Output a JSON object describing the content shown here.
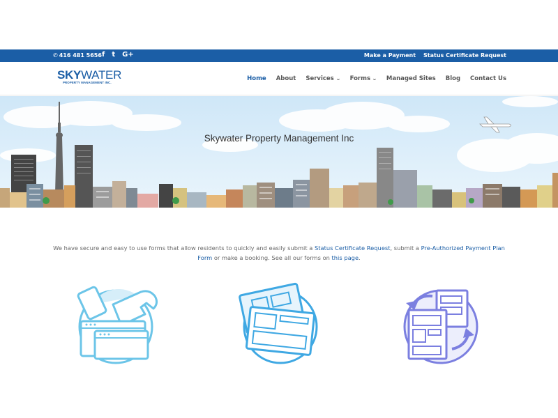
{
  "topbar": {
    "phone": "416 481 5656",
    "social": [
      "f",
      "t",
      "G+"
    ],
    "links": [
      "Make a Payment",
      "Status Certificate Request"
    ]
  },
  "logo": {
    "sky": "SKY",
    "water": "WATER",
    "sub": "PROPERTY MANAGEMENT INC."
  },
  "nav": {
    "items": [
      {
        "label": "Home",
        "active": true
      },
      {
        "label": "About"
      },
      {
        "label": "Services",
        "dropdown": true
      },
      {
        "label": "Forms",
        "dropdown": true
      },
      {
        "label": "Managed Sites"
      },
      {
        "label": "Blog"
      },
      {
        "label": "Contact Us"
      }
    ]
  },
  "hero": {
    "title": "Skywater Property Management Inc"
  },
  "intro": {
    "text1": "We have secure and easy to use forms that allow residents to quickly and easily submit a ",
    "link1": "Status Certificate Request",
    "text2": ", submit a ",
    "link2": "Pre-Authorized Payment Plan Form",
    "text3": " or make a booking. See all our forms on ",
    "link3": "this page",
    "text4": "."
  },
  "colors": {
    "brand": "#1b5ea6",
    "sky": "#d7ecf9",
    "icon_blue": "#6cc5e8",
    "icon_purple": "#7b7fe0"
  },
  "icons": [
    "tools-window-icon",
    "documents-icon",
    "sync-pages-icon"
  ]
}
